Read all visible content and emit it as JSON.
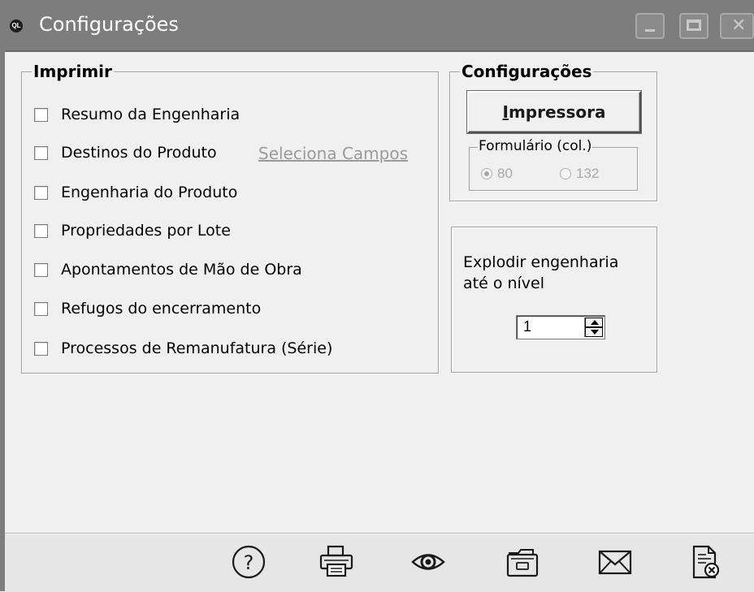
{
  "window": {
    "title": "Configurações",
    "app_icon_text": "QL"
  },
  "imprimir": {
    "title": "Imprimir",
    "items": [
      {
        "label": "Resumo da Engenharia",
        "checked": false
      },
      {
        "label": "Destinos do Produto",
        "checked": false
      },
      {
        "label": "Engenharia do Produto",
        "checked": false
      },
      {
        "label": "Propriedades por Lote",
        "checked": false
      },
      {
        "label": "Apontamentos de Mão de Obra",
        "checked": false
      },
      {
        "label": "Refugos do encerramento",
        "checked": false
      },
      {
        "label": "Processos de Remanufatura (Série)",
        "checked": false
      }
    ],
    "selecionar_campos": "Seleciona Campos"
  },
  "configuracoes": {
    "title": "Configurações",
    "printer_button_underlined": "I",
    "printer_button_rest": "mpressora",
    "formulario_title": "Formulário (col.)",
    "radio_80": "80",
    "radio_132": "132",
    "selected_columns": "80"
  },
  "explodir": {
    "line1": "Explodir engenharia",
    "line2": "até o nível",
    "value": "1"
  },
  "toolbar": {
    "icons": [
      "help-icon",
      "print-icon",
      "preview-icon",
      "folder-icon",
      "email-icon",
      "close-document-icon"
    ]
  },
  "colors": {
    "titlebar": "#7d7d7d",
    "window_bg": "#f0f0f0",
    "disabled_text": "#a8a8a8",
    "link_text": "#9b9b9b"
  }
}
